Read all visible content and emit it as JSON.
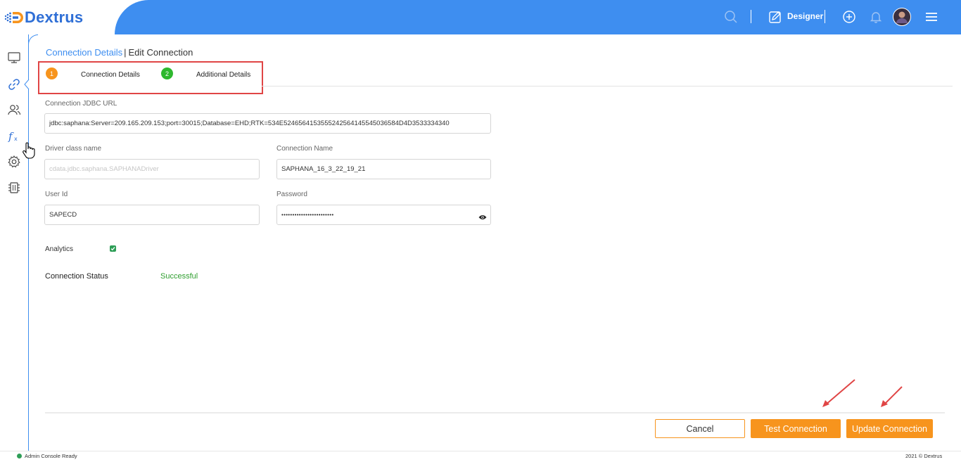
{
  "app": {
    "logo_text": "Dextrus"
  },
  "header": {
    "designer_label": "Designer"
  },
  "breadcrumb": {
    "link": "Connection Details",
    "separator": "|",
    "current": "Edit Connection"
  },
  "steps": [
    {
      "number": "1",
      "label": "Connection Details",
      "color": "#f7941d"
    },
    {
      "number": "2",
      "label": "Additional Details",
      "color": "#2eb82e"
    }
  ],
  "form": {
    "jdbc_url": {
      "label": "Connection JDBC URL",
      "value": "jdbc:saphana:Server=209.165.209.153;port=30015;Database=EHD;RTK=534E5246564153555242564145545036584D4D3533334340"
    },
    "driver_class": {
      "label": "Driver class name",
      "placeholder": "cdata.jdbc.saphana.SAPHANADriver"
    },
    "connection_name": {
      "label": "Connection Name",
      "value": "SAPHANA_16_3_22_19_21"
    },
    "user_id": {
      "label": "User Id",
      "value": "SAPECD"
    },
    "password": {
      "label": "Password",
      "value": "••••••••••••••••••••••••"
    },
    "analytics": {
      "label": "Analytics",
      "checked": true
    },
    "status": {
      "label": "Connection Status",
      "value": "Successful"
    }
  },
  "buttons": {
    "cancel": "Cancel",
    "test": "Test Connection",
    "update": "Update Connection"
  },
  "statusbar": {
    "text": "Admin Console Ready",
    "copyright": "2021 © Dextrus"
  },
  "colors": {
    "brand_blue": "#3e8ef0",
    "accent_orange": "#f7941d",
    "success_green": "#2e9e2e",
    "highlight_red": "#e04545"
  }
}
